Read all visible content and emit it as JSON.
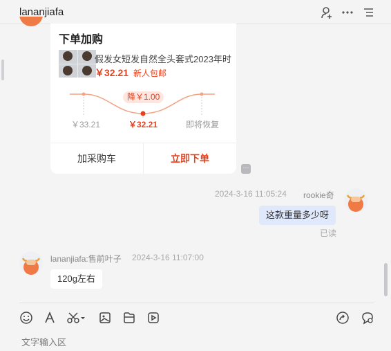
{
  "header": {
    "title": "lananjiafa",
    "icons": [
      "add-user-icon",
      "more-icon",
      "list-icon"
    ]
  },
  "product_card": {
    "title": "下单加购",
    "product_name": "假发女短发自然全头套式2023年时",
    "price": "￥32.21",
    "new_user_tag": "新人包邮",
    "drop_badge": "降￥1.00",
    "price_labels": {
      "original": "￥33.21",
      "current": "￥32.21",
      "recover": "即将恢复"
    },
    "add_cart_label": "加采购车",
    "buy_now_label": "立即下单",
    "more_label": "···"
  },
  "messages": [
    {
      "side": "right",
      "time": "2024-3-16 11:05:24",
      "sender": "rookie奇",
      "text": "这款重量多少呀",
      "status": "已读"
    },
    {
      "side": "left",
      "sender": "lananjiafa:售前叶子",
      "time": "2024-3-16 11:07:00",
      "text": "120g左右"
    }
  ],
  "toolbar": {
    "icons": [
      "emoji-icon",
      "font-icon",
      "scissors-icon",
      "image-icon",
      "file-icon",
      "video-icon",
      "share-icon",
      "settings-chat-icon"
    ]
  },
  "input": {
    "placeholder": "文字输入区"
  },
  "colors": {
    "accent": "#e8401c",
    "bubble_self": "#dfe9fb",
    "background": "#f4f4f5"
  }
}
